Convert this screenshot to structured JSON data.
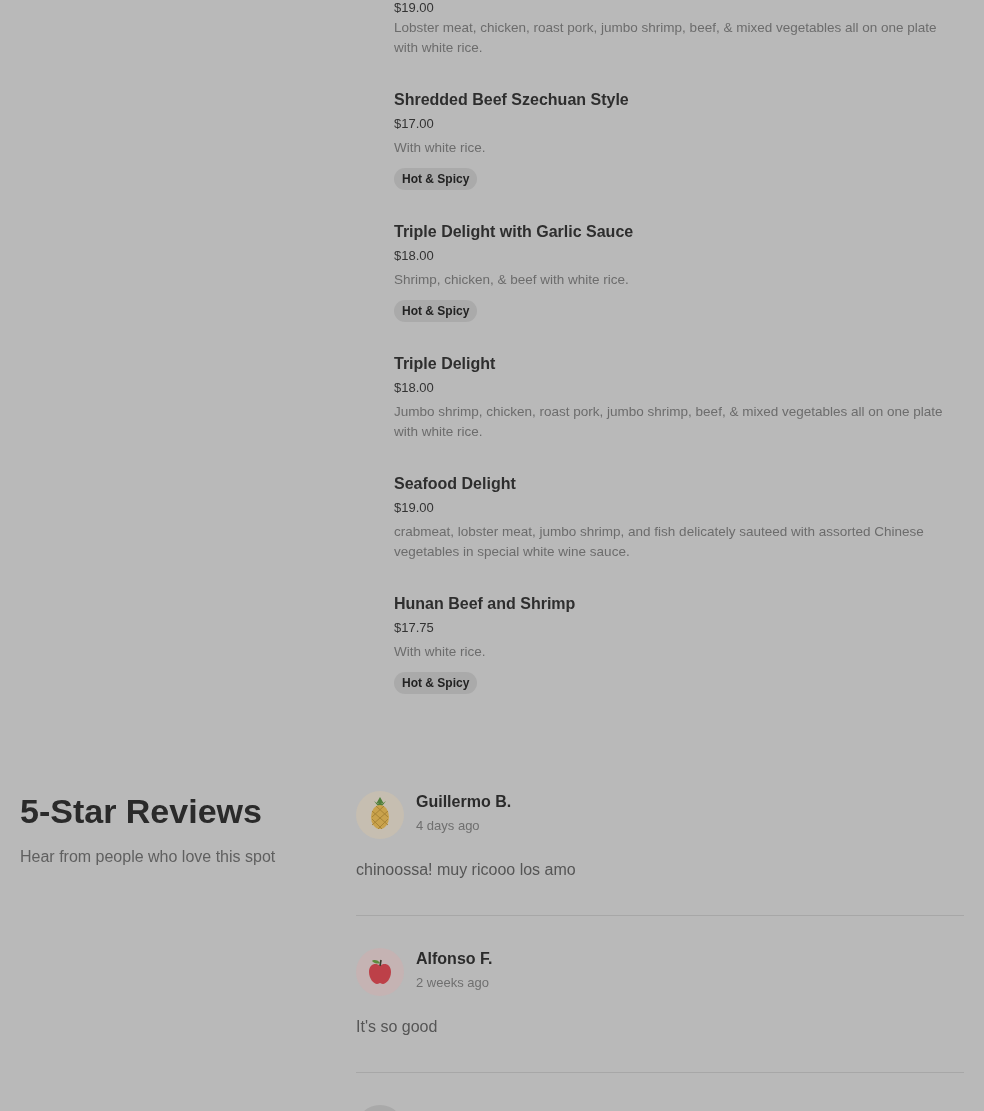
{
  "menu": {
    "items": [
      {
        "price": "$19.00",
        "description": "Lobster meat, chicken, roast pork, jumbo shrimp, beef, & mixed vegetables all on one plate with white rice."
      },
      {
        "name": "Shredded Beef Szechuan Style",
        "price": "$17.00",
        "description": "With white rice.",
        "tags": [
          "Hot & Spicy"
        ]
      },
      {
        "name": "Triple Delight with Garlic Sauce",
        "price": "$18.00",
        "description": "Shrimp, chicken, & beef with white rice.",
        "tags": [
          "Hot & Spicy"
        ]
      },
      {
        "name": "Triple Delight",
        "price": "$18.00",
        "description": "Jumbo shrimp, chicken, roast pork, jumbo shrimp, beef, & mixed vegetables all on one plate with white rice."
      },
      {
        "name": "Seafood Delight",
        "price": "$19.00",
        "description": "crabmeat, lobster meat, jumbo shrimp, and fish delicately sauteed with assorted Chinese vegetables in special white wine sauce."
      },
      {
        "name": "Hunan Beef and Shrimp",
        "price": "$17.75",
        "description": "With white rice.",
        "tags": [
          "Hot & Spicy"
        ]
      }
    ]
  },
  "reviews": {
    "title": "5-Star Reviews",
    "subtitle": "Hear from people who love this spot",
    "items": [
      {
        "avatar": {
          "kind": "pineapple"
        },
        "name": "Guillermo B.",
        "time": "4 days ago",
        "text": "chinoossa! muy ricooo los amo"
      },
      {
        "avatar": {
          "kind": "apple"
        },
        "name": "Alfonso F.",
        "time": "2 weeks ago",
        "text": "It's so good"
      },
      {
        "avatar": {
          "kind": "plain"
        }
      }
    ]
  }
}
